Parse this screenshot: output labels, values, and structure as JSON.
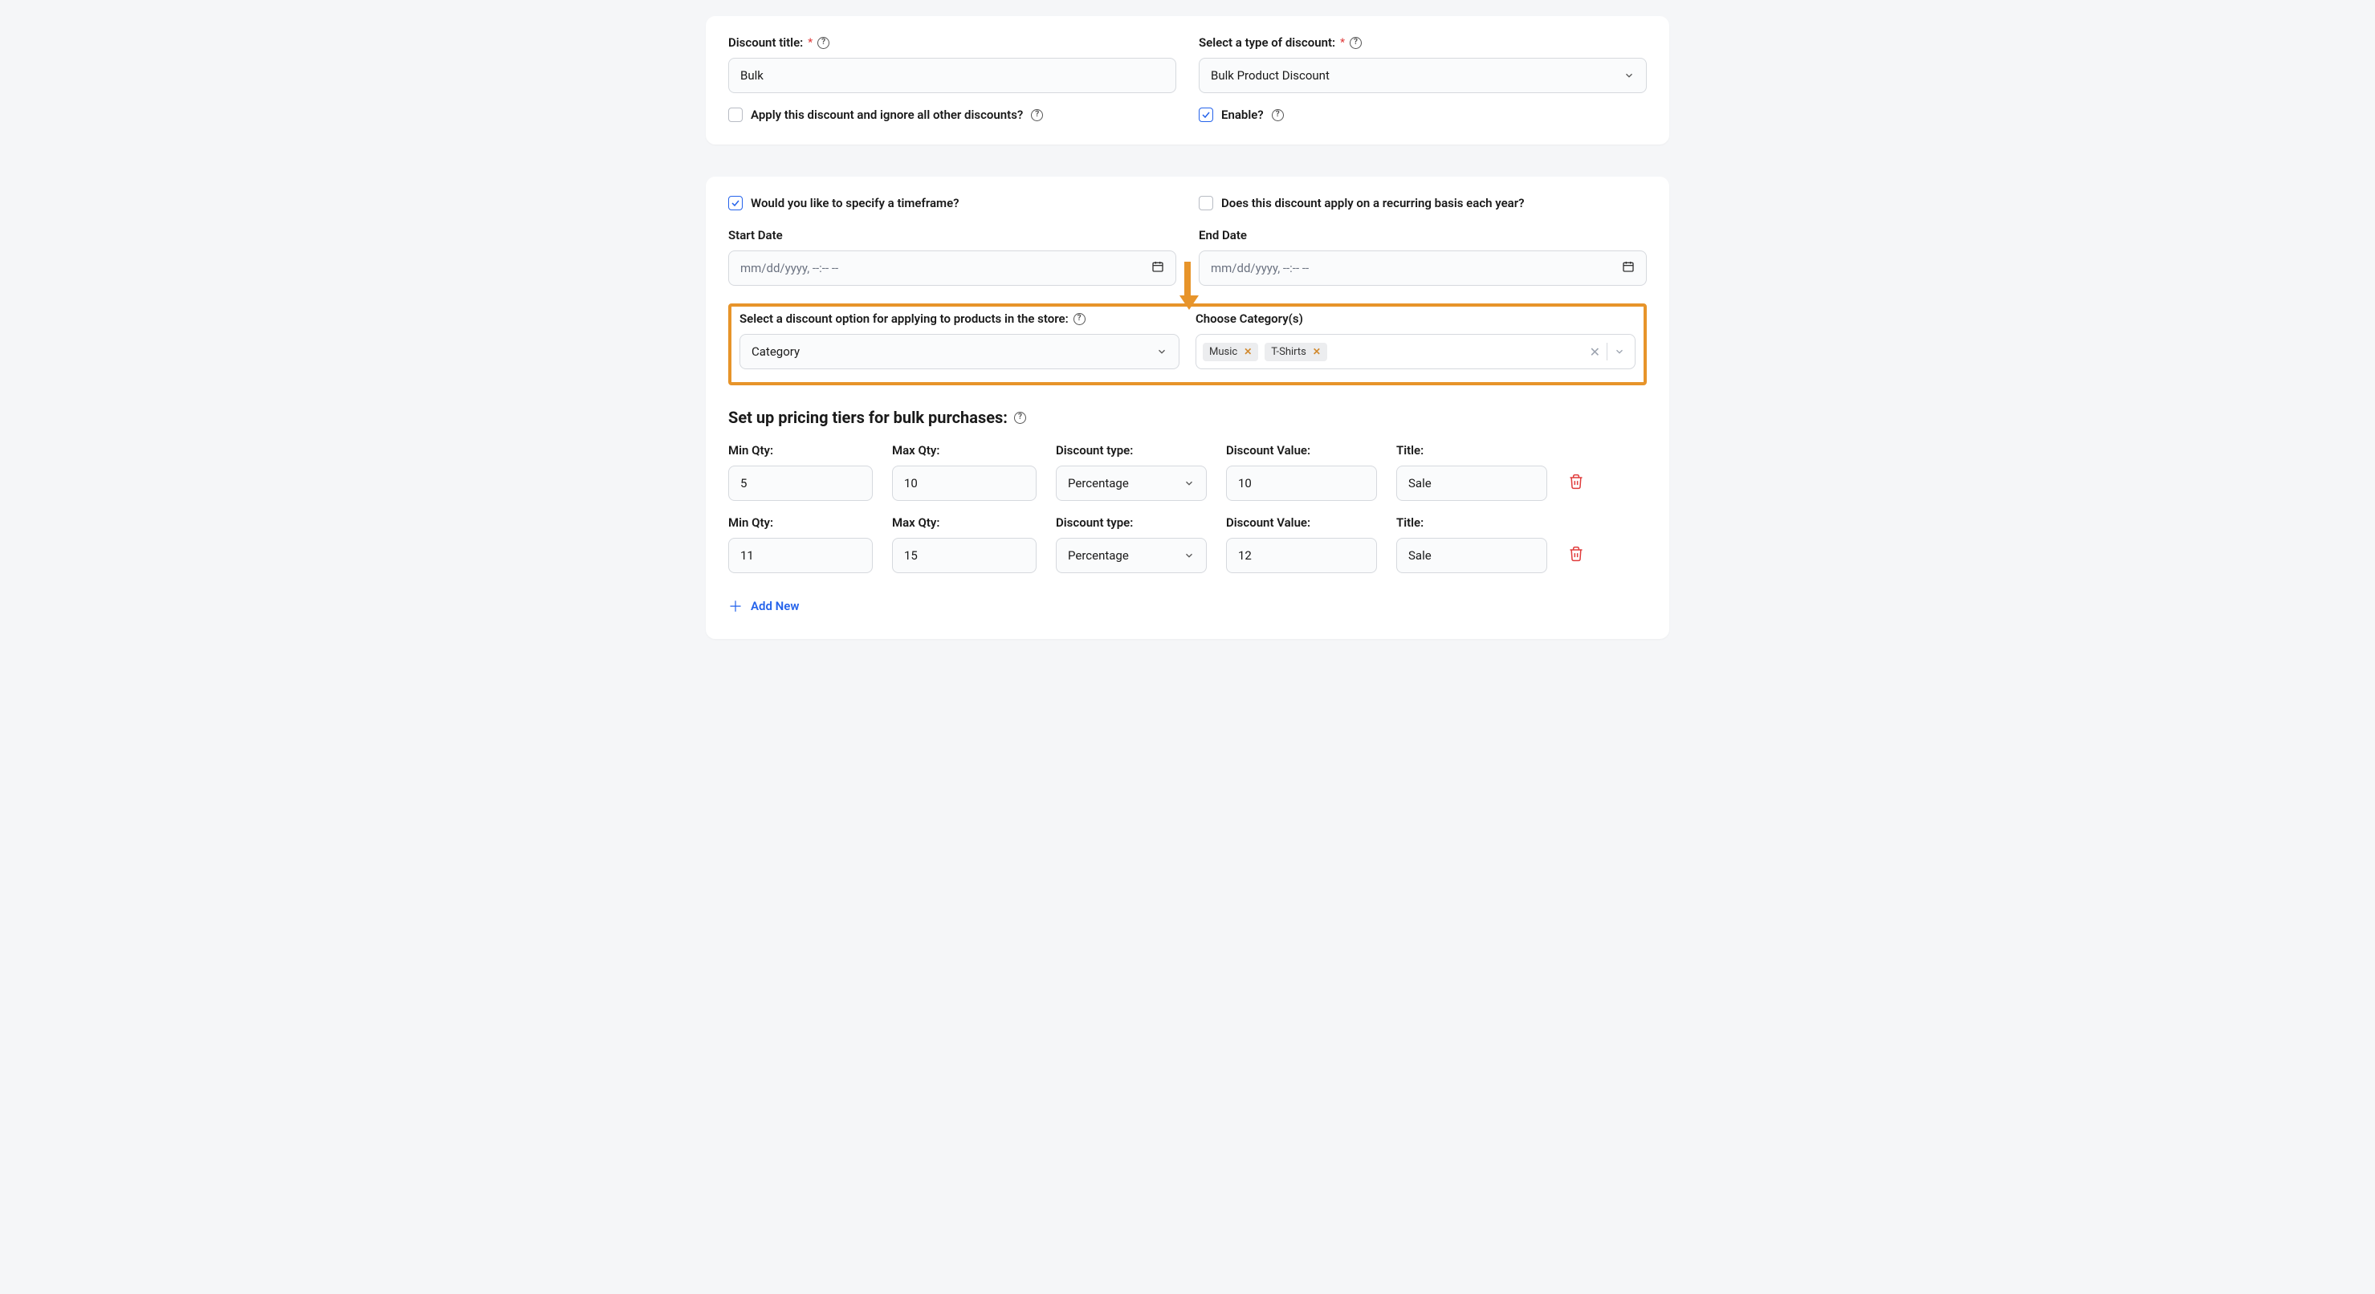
{
  "card1": {
    "title_label": "Discount title:",
    "title_value": "Bulk",
    "type_label": "Select a type of discount:",
    "type_value": "Bulk Product Discount",
    "ignore_label": "Apply this discount and ignore all other discounts?",
    "ignore_checked": false,
    "enable_label": "Enable?",
    "enable_checked": true
  },
  "card2": {
    "timeframe_label": "Would you like to specify a timeframe?",
    "timeframe_checked": true,
    "recurring_label": "Does this discount apply on a recurring basis each year?",
    "recurring_checked": false,
    "start_label": "Start Date",
    "end_label": "End Date",
    "date_placeholder": "mm/dd/yyyy, --:-- --",
    "option_label": "Select a discount option for applying to products in the store:",
    "option_value": "Category",
    "categories_label": "Choose Category(s)",
    "categories": [
      "Music",
      "T-Shirts"
    ],
    "tiers_title": "Set up pricing tiers for bulk purchases:",
    "tier_headers": {
      "min": "Min Qty:",
      "max": "Max Qty:",
      "dtype": "Discount type:",
      "dval": "Discount Value:",
      "title": "Title:"
    },
    "tiers": [
      {
        "min": "5",
        "max": "10",
        "dtype": "Percentage",
        "dval": "10",
        "title": "Sale"
      },
      {
        "min": "11",
        "max": "15",
        "dtype": "Percentage",
        "dval": "12",
        "title": "Sale"
      }
    ],
    "add_new": "Add New"
  }
}
